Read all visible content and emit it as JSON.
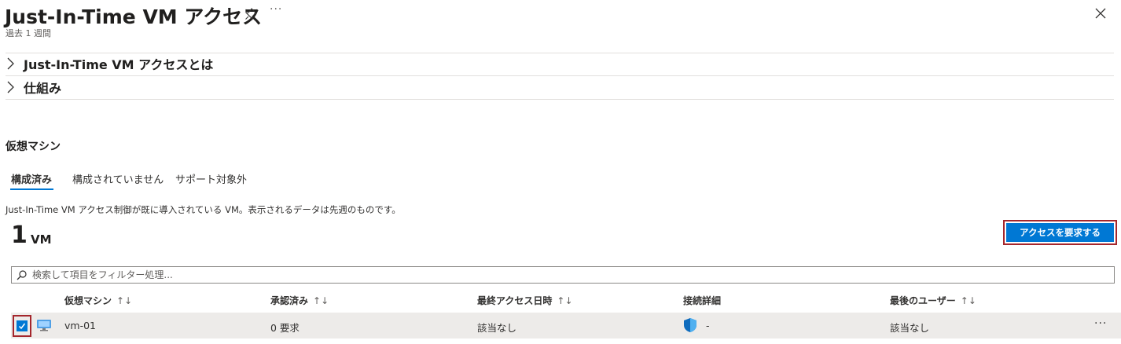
{
  "header": {
    "title": "Just-In-Time VM アクセス",
    "subtitle": "過去 1 週間",
    "more_label": "···"
  },
  "expanders": [
    {
      "label": "Just-In-Time VM アクセスとは"
    },
    {
      "label": "仕組み"
    }
  ],
  "section": {
    "title": "仮想マシン",
    "tabs": [
      {
        "label": "構成済み",
        "active": true
      },
      {
        "label": "構成されていません",
        "active": false
      },
      {
        "label": "サポート対象外",
        "active": false
      }
    ],
    "description": "Just-In-Time VM アクセス制御が既に導入されている VM。表示されるデータは先週のものです。",
    "count_value": "1",
    "count_unit": "VM",
    "request_button": "アクセスを要求する"
  },
  "search": {
    "placeholder": "検索して項目をフィルター処理..."
  },
  "table": {
    "columns": [
      {
        "label": "仮想マシン",
        "sort": "↑↓"
      },
      {
        "label": "承認済み",
        "sort": "↑↓"
      },
      {
        "label": "最終アクセス日時",
        "sort": "↑↓"
      },
      {
        "label": "接続詳細",
        "sort": ""
      },
      {
        "label": "最後のユーザー",
        "sort": "↑↓"
      }
    ],
    "rows": [
      {
        "checked": true,
        "name": "vm-01",
        "approved": "0 要求",
        "last_access": "該当なし",
        "connection": "-",
        "last_user": "該当なし",
        "more": "···"
      }
    ]
  },
  "colors": {
    "accent": "#0078d4",
    "highlight_border": "#a4262c",
    "row_selected": "#edebe9"
  }
}
